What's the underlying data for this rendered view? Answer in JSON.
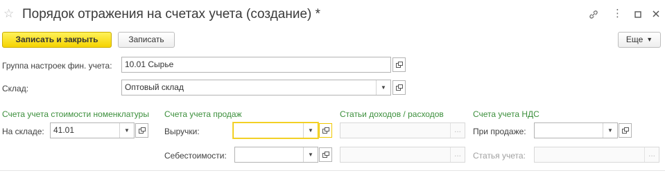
{
  "window": {
    "title": "Порядок отражения на счетах учета (создание) *",
    "favorite_icon": "star-icon",
    "icons": [
      "link-icon",
      "more-icon",
      "maximize-icon",
      "close-icon"
    ]
  },
  "toolbar": {
    "save_close_label": "Записать и закрыть",
    "save_label": "Записать",
    "more_label": "Еще"
  },
  "form": {
    "group_label": "Группа настроек фин. учета:",
    "group_value": "10.01 Сырье",
    "warehouse_label": "Склад:",
    "warehouse_value": "Оптовый склад"
  },
  "sections": {
    "inventory": {
      "title": "Счета учета стоимости номенклатуры",
      "in_stock_label": "На складе:",
      "in_stock_value": "41.01"
    },
    "sales": {
      "title": "Счета учета продаж",
      "revenue_label": "Выручки:",
      "revenue_value": "",
      "cost_label": "Себестоимости:",
      "cost_value": ""
    },
    "income_expense": {
      "title": "Статьи доходов / расходов",
      "field1_value": "",
      "field2_value": "",
      "select_button": "..."
    },
    "vat": {
      "title": "Счета учета НДС",
      "on_sale_label": "При продаже:",
      "on_sale_value": "",
      "account_item_label": "Статья учета:",
      "account_item_value": "",
      "select_button": "..."
    }
  },
  "colors": {
    "primary_button": "#f5d300",
    "section_title": "#3c8f3c",
    "focus_border": "#f0c800"
  }
}
